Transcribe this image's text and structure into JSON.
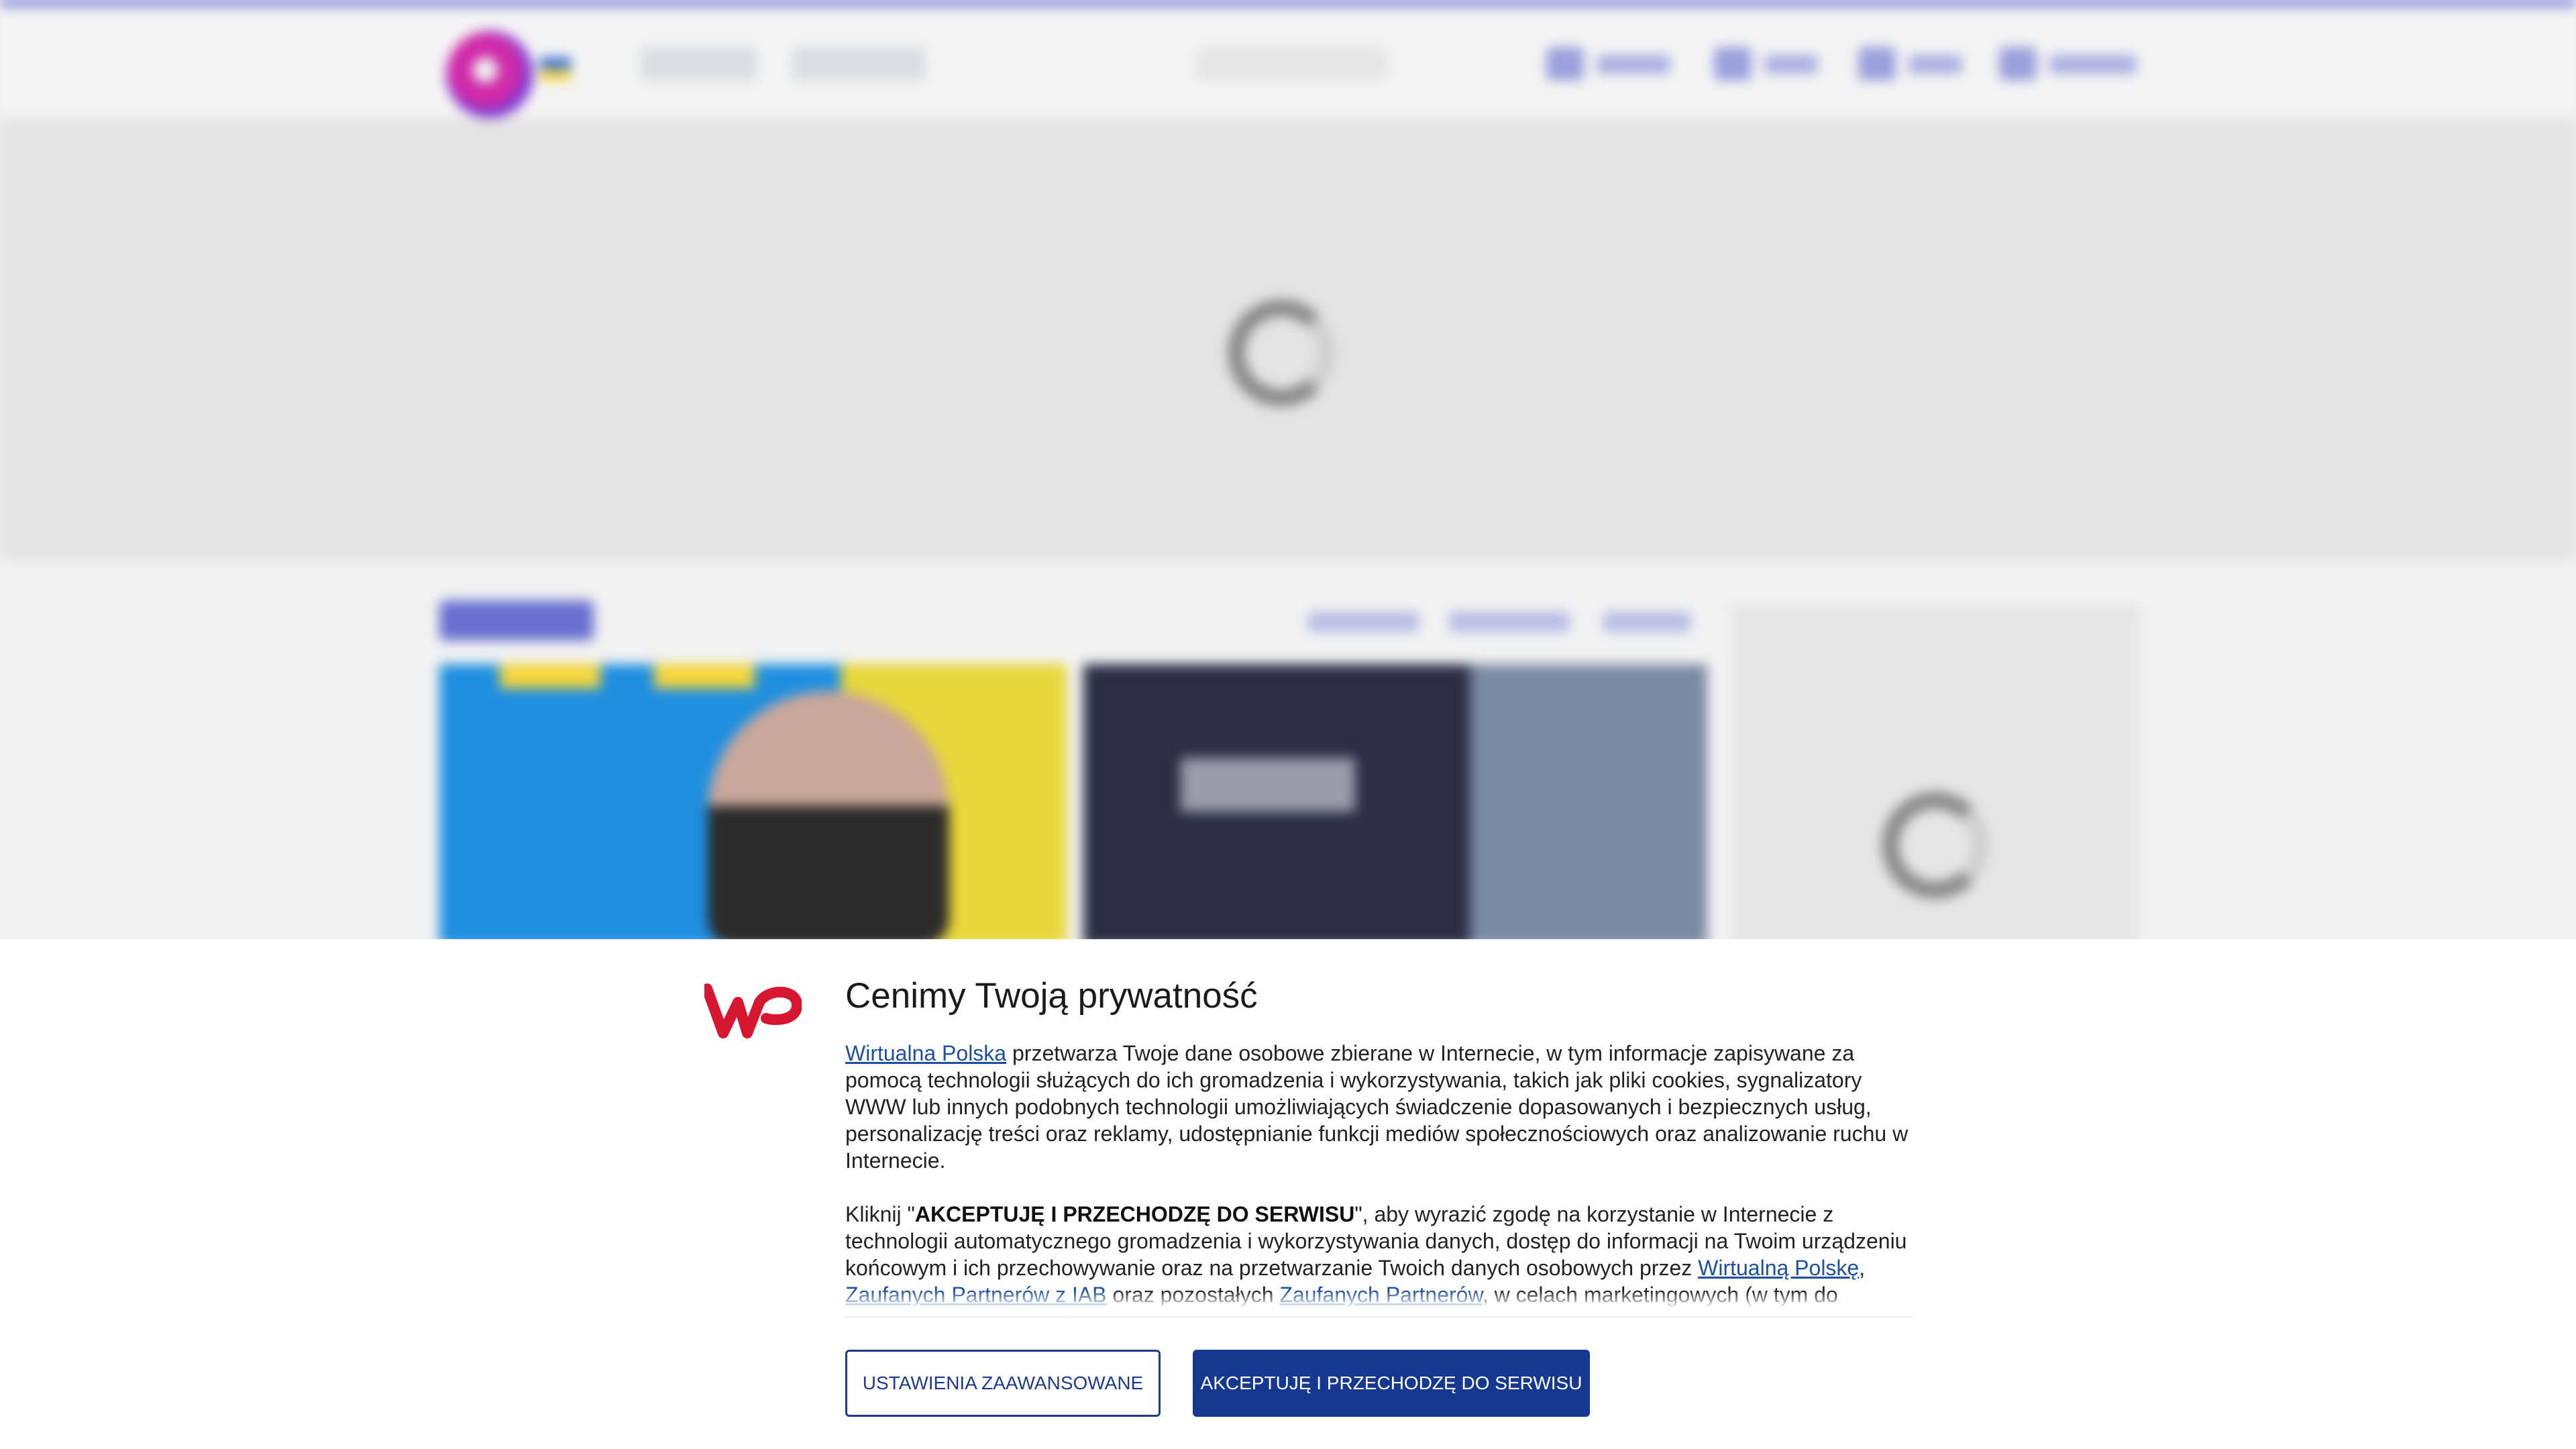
{
  "consent": {
    "title": "Cenimy Twoją prywatność",
    "para1": {
      "link_wp": "Wirtualna Polska",
      "text": " przetwarza Twoje dane osobowe zbierane w Internecie, w tym informacje zapisywane za pomocą technologii służących do ich gromadzenia i wykorzystywania, takich jak pliki cookies, sygnalizatory WWW lub innych podobnych technologii umożliwiających świadczenie dopasowanych i bezpiecznych usług, personalizację treści oraz reklamy, udostępnianie funkcji mediów społecznościowych oraz analizowanie ruchu w Internecie."
    },
    "para2": {
      "prefix": "Kliknij \"",
      "bold": "AKCEPTUJĘ I PRZECHODZĘ DO SERWISU",
      "mid": "\", aby wyrazić zgodę na korzystanie w Internecie z technologii automatycznego gromadzenia i wykorzystywania danych, dostęp do informacji na Twoim urządzeniu końcowym i ich przechowywanie oraz na przetwarzanie Twoich danych osobowych przez ",
      "link_wp": "Wirtualną Polskę",
      "comma": ", ",
      "link_iab": "Zaufanych Partnerów z IAB",
      "and": " oraz pozostałych ",
      "link_partners": "Zaufanych Partnerów",
      "suffix": ", w celach marketingowych (w tym do zautomatyzowanego dopasowania reklam do Twoich zainteresowań i mierzenia"
    },
    "buttons": {
      "advanced": "USTAWIENIA ZAAWANSOWANE",
      "accept": "AKCEPTUJĘ I PRZECHODZĘ DO SERWISU"
    },
    "colors": {
      "logo_red": "#d7172f",
      "link_blue": "#1e4fa0",
      "button_blue": "#16398f"
    }
  },
  "background": {
    "accent": "#3b45c4",
    "icons": [
      "wp-logo-icon",
      "loading-spinner-icon"
    ]
  }
}
